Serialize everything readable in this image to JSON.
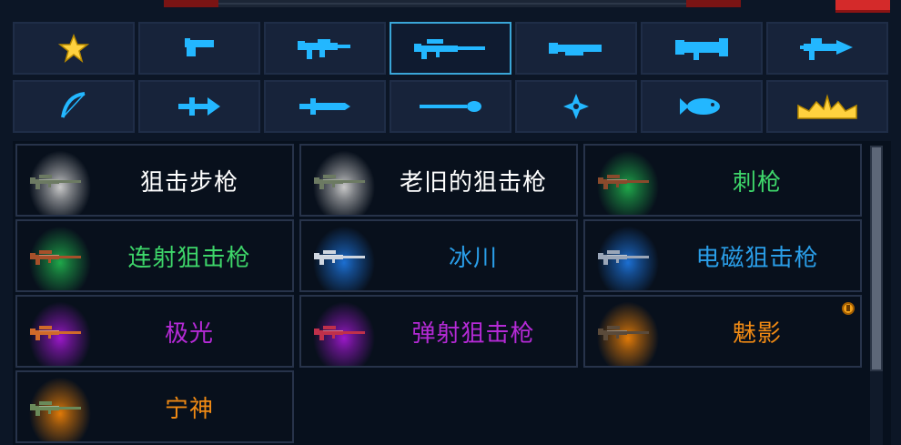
{
  "category_tabs": [
    {
      "icon": "star-icon",
      "active": false
    },
    {
      "icon": "pistol-icon",
      "active": false
    },
    {
      "icon": "rifle-icon",
      "active": false
    },
    {
      "icon": "sniper-icon",
      "active": true
    },
    {
      "icon": "shotgun-icon",
      "active": false
    },
    {
      "icon": "launcher-icon",
      "active": false
    },
    {
      "icon": "laser-gun-icon",
      "active": false
    },
    {
      "icon": "bow-icon",
      "active": false
    },
    {
      "icon": "crossbow-icon",
      "active": false
    },
    {
      "icon": "sword-icon",
      "active": false
    },
    {
      "icon": "spear-icon",
      "active": false
    },
    {
      "icon": "shuriken-icon",
      "active": false
    },
    {
      "icon": "fish-icon",
      "active": false
    },
    {
      "icon": "crown-icon",
      "active": false
    }
  ],
  "weapons": [
    {
      "name": "狙击步枪",
      "name_color": "#ffffff",
      "glow": "#c8c8c8",
      "gun_color": "#6c7a62",
      "badge": false
    },
    {
      "name": "老旧的狙击枪",
      "name_color": "#ffffff",
      "glow": "#c8c8c8",
      "gun_color": "#6c7a62",
      "badge": false
    },
    {
      "name": "刺枪",
      "name_color": "#3ed66a",
      "glow": "#1fa84a",
      "gun_color": "#8a4a2c",
      "badge": false
    },
    {
      "name": "连射狙击枪",
      "name_color": "#3ed66a",
      "glow": "#1fa84a",
      "gun_color": "#a6502a",
      "badge": false
    },
    {
      "name": "冰川",
      "name_color": "#2a9ee8",
      "glow": "#1c6fd2",
      "gun_color": "#cfd6e0",
      "badge": false
    },
    {
      "name": "电磁狙击枪",
      "name_color": "#2a9ee8",
      "glow": "#1c6fd2",
      "gun_color": "#9aa6b8",
      "badge": false
    },
    {
      "name": "极光",
      "name_color": "#b52ad6",
      "glow": "#9a18c8",
      "gun_color": "#d06a2a",
      "badge": false
    },
    {
      "name": "弹射狙击枪",
      "name_color": "#b52ad6",
      "glow": "#9a18c8",
      "gun_color": "#c0304a",
      "badge": false
    },
    {
      "name": "魅影",
      "name_color": "#f08a14",
      "glow": "#e07a08",
      "gun_color": "#5a4a3a",
      "badge": true
    },
    {
      "name": "宁神",
      "name_color": "#f08a14",
      "glow": "#e07a08",
      "gun_color": "#6a8a5a",
      "badge": false
    }
  ],
  "colors": {
    "tab_icon": "#23b7ff",
    "star_icon": "#ffd23f",
    "crown_icon": "#ffd23f"
  }
}
